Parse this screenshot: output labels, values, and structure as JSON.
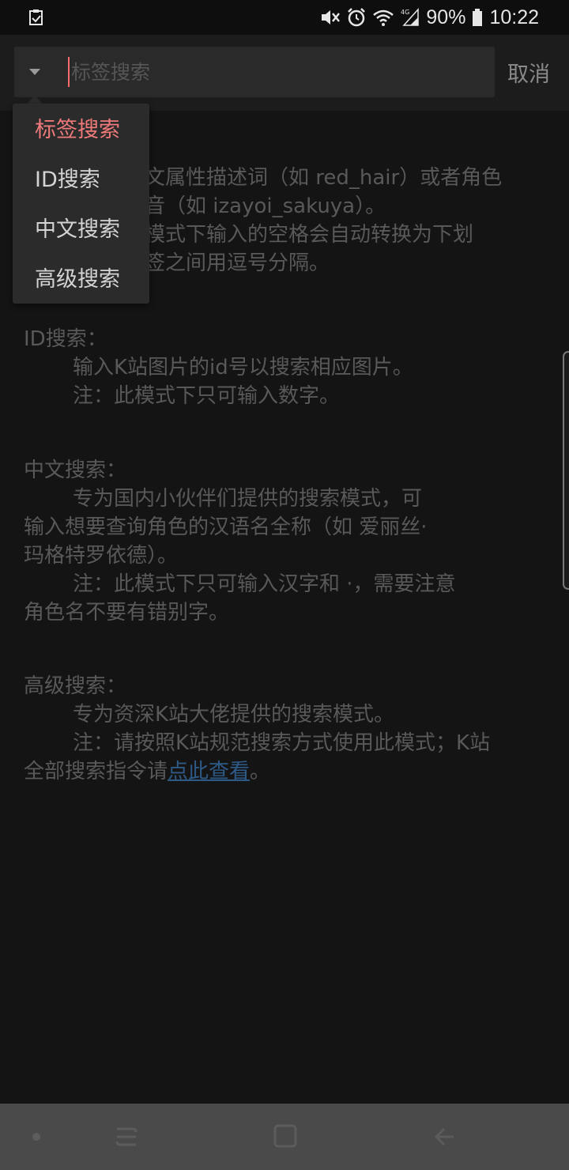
{
  "status_bar": {
    "battery": "90%",
    "time": "10:22",
    "icons": [
      "task-checkbox-icon",
      "mute-icon",
      "alarm-icon",
      "wifi-icon",
      "signal-4g-icon",
      "battery-icon"
    ]
  },
  "search": {
    "placeholder": "标签搜索",
    "cancel_label": "取消"
  },
  "dropdown": {
    "items": [
      {
        "label": "标签搜索",
        "selected": true
      },
      {
        "label": "ID搜索",
        "selected": false
      },
      {
        "label": "中文搜索",
        "selected": false
      },
      {
        "label": "高级搜索",
        "selected": false
      }
    ]
  },
  "help": {
    "tag_lines": [
      "文属性描述词（如 red_hair）或者角色",
      "音（如 izayoi_sakuya）。",
      "模式下输入的空格会自动转换为下划",
      "签之间用逗号分隔。"
    ],
    "id_title": "ID搜索：",
    "id_line1": "输入K站图片的id号以搜索相应图片。",
    "id_line2": "注：此模式下只可输入数字。",
    "cn_title": "中文搜索：",
    "cn_line1": "专为国内小伙伴们提供的搜索模式，可",
    "cn_line2": "输入想要查询角色的汉语名全称（如 爱丽丝·",
    "cn_line3": "玛格特罗依德）。",
    "cn_line4": "注：此模式下只可输入汉字和 ·，需要注意",
    "cn_line5": "角色名不要有错别字。",
    "adv_title": "高级搜索：",
    "adv_line1": "专为资深K站大佬提供的搜索模式。",
    "adv_line2": "注：请按照K站规范搜索方式使用此模式；K站",
    "adv_line3_prefix": "全部搜索指令请",
    "adv_link": "点此查看",
    "adv_line3_suffix": "。"
  },
  "nav_bar": {
    "icons": [
      "dot-icon",
      "recent-apps-icon",
      "home-icon",
      "back-icon"
    ]
  }
}
